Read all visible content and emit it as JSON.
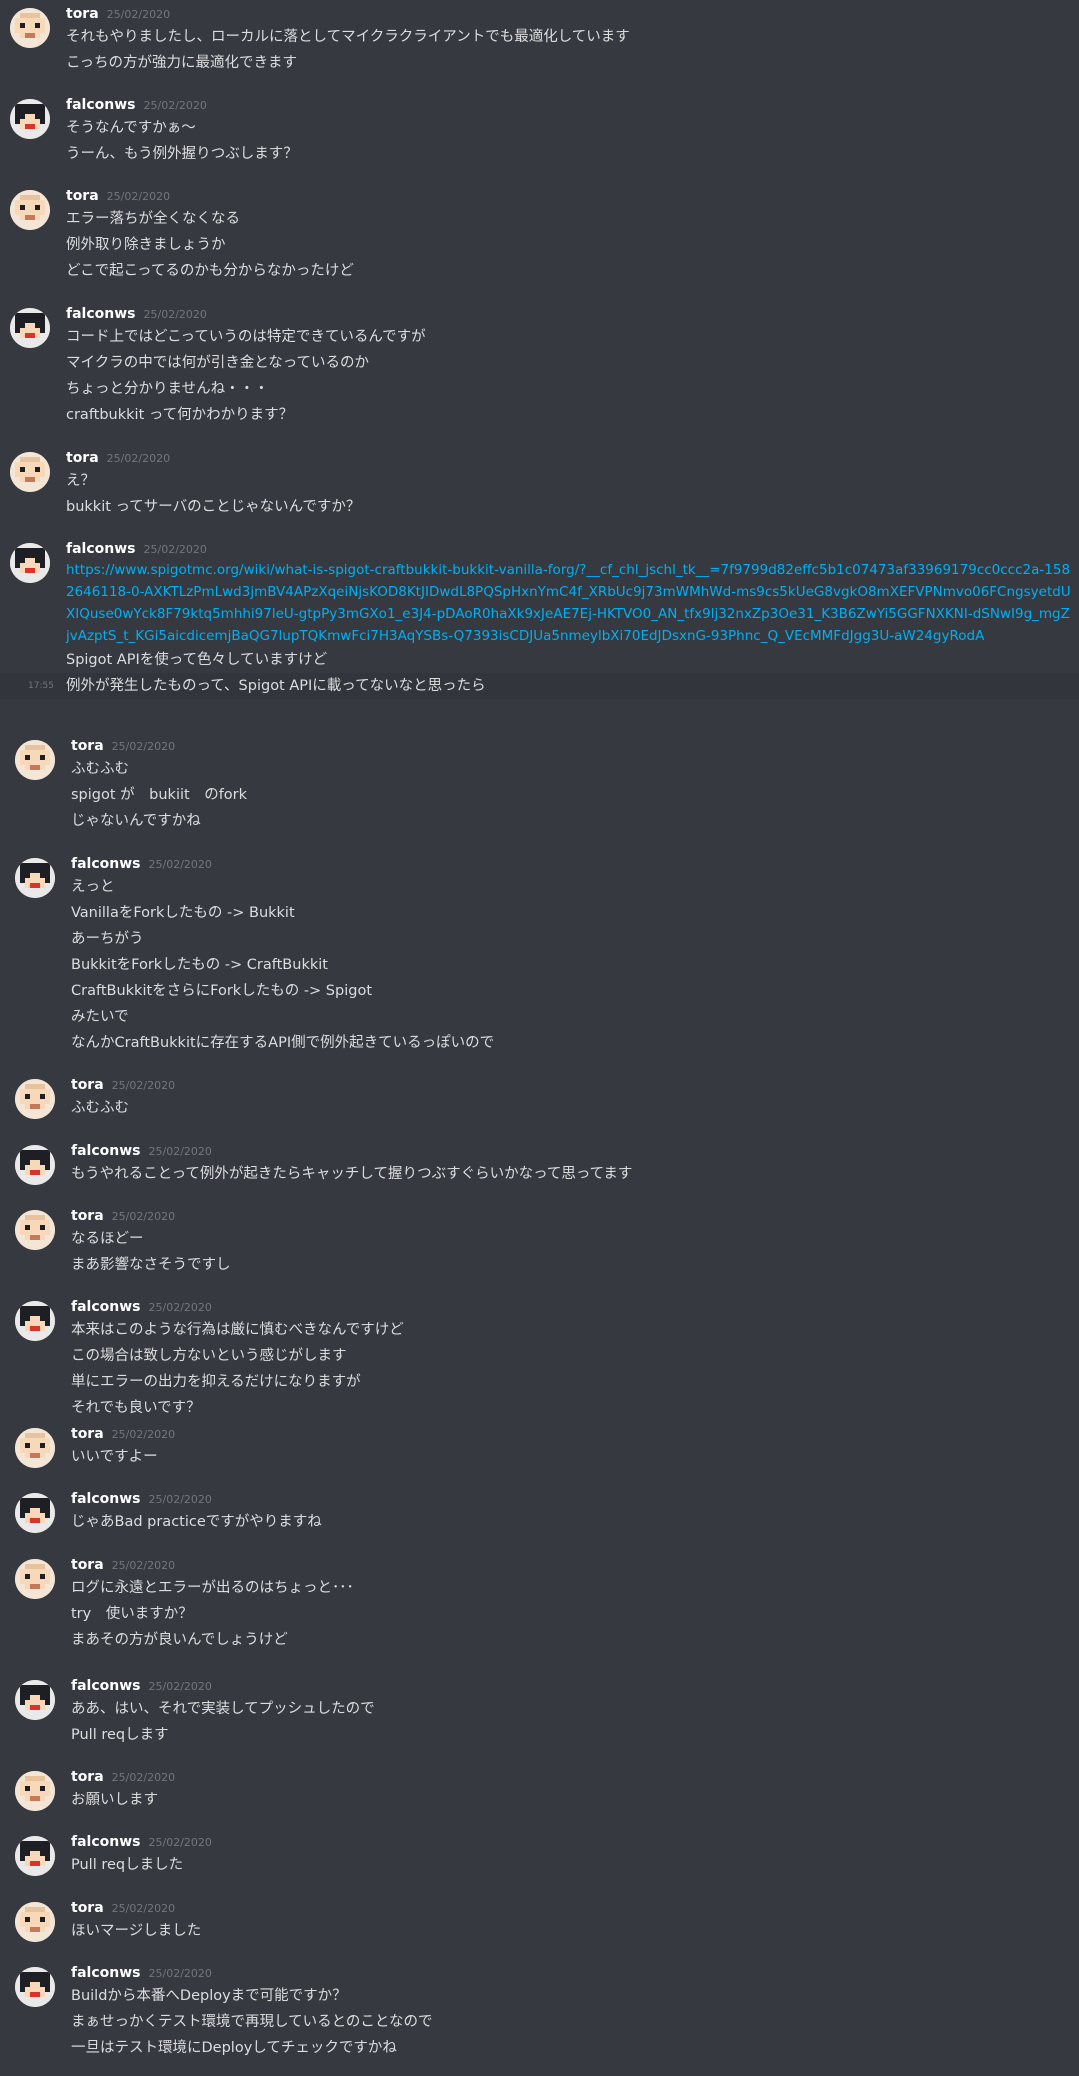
{
  "channel": {
    "messages": [
      {
        "author": "tora",
        "date": "25/02/2020",
        "lines": [
          "それもやりましたし、ローカルに落としてマイクラクライアントでも最適化しています",
          "こっちの方が強力に最適化できます"
        ]
      },
      {
        "author": "falconws",
        "date": "25/02/2020",
        "lines": [
          "そうなんですかぁ〜",
          "うーん、もう例外握りつぶします？"
        ]
      },
      {
        "author": "tora",
        "date": "25/02/2020",
        "lines": [
          "エラー落ちが全くなくなる",
          "例外取り除きましょうか",
          "どこで起こってるのかも分からなかったけど"
        ]
      },
      {
        "author": "falconws",
        "date": "25/02/2020",
        "lines": [
          "コード上ではどこっていうのは特定できているんですが",
          "マイクラの中では何が引き金となっているのか",
          "ちょっと分かりませんね・・・",
          "craftbukkit って何かわかります？"
        ]
      },
      {
        "author": "tora",
        "date": "25/02/2020",
        "lines": [
          "え？",
          "bukkit ってサーバのことじゃないんですか？"
        ]
      },
      {
        "author": "falconws",
        "date": "25/02/2020",
        "link": "https://www.spigotmc.org/wiki/what-is-spigot-craftbukkit-bukkit-vanilla-forg/?__cf_chl_jschl_tk__=7f9799d82effc5b1c07473af33969179cc0ccc2a-1582646118-0-AXKTLzPmLwd3jmBV4APzXqeiNjsKOD8KtJIDwdL8PQSpHxnYmC4f_XRbUc9j73mWMhWd-ms9cs5kUeG8vgkO8mXEFVPNmvo06FCngsyetdUXIQuse0wYck8F79ktq5mhhi97leU-gtpPy3mGXo1_e3J4-pDAoR0haXk9xJeAE7Ej-HKTVO0_AN_tfx9lj32nxZp3Oe31_K3B6ZwYi5GGFNXKNI-dSNwI9g_mgZjvAzptS_t_KGi5aicdicemjBaQG7lupTQKmwFci7H3AqYSBs-Q7393isCDJUa5nmeylbXi70EdJDsxnG-93Phnc_Q_VEcMMFdJgg3U-aW24gyRodA",
        "lines": [
          "Spigot APIを使って色々していますけど"
        ],
        "followup": {
          "time": "17:55",
          "text": "例外が発生したものって、Spigot APIに載ってないなと思ったら"
        }
      },
      {
        "author": "tora",
        "date": "25/02/2020",
        "lines": [
          "ふむふむ",
          "spigot が　bukiit　のfork",
          "じゃないんですかね"
        ]
      },
      {
        "author": "falconws",
        "date": "25/02/2020",
        "lines": [
          "えっと",
          "VanillaをForkしたもの -> Bukkit",
          "あーちがう",
          "BukkitをForkしたもの -> CraftBukkit",
          "CraftBukkitをさらにForkしたもの -> Spigot",
          "みたいで",
          "なんかCraftBukkitに存在するAPI側で例外起きているっぽいので"
        ]
      },
      {
        "author": "tora",
        "date": "25/02/2020",
        "lines": [
          "ふむふむ"
        ]
      },
      {
        "author": "falconws",
        "date": "25/02/2020",
        "lines": [
          "もうやれることって例外が起きたらキャッチして握りつぶすぐらいかなって思ってます"
        ]
      },
      {
        "author": "tora",
        "date": "25/02/2020",
        "lines": [
          "なるほどー",
          "まあ影響なさそうですし"
        ]
      },
      {
        "author": "falconws",
        "date": "25/02/2020",
        "lines": [
          "本来はこのような行為は厳に慎むべきなんですけど",
          "この場合は致し方ないという感じがします",
          "単にエラーの出力を抑えるだけになりますが",
          "それでも良いです？"
        ]
      },
      {
        "author": "tora",
        "date": "25/02/2020",
        "lines": [
          "いいですよー"
        ]
      },
      {
        "author": "falconws",
        "date": "25/02/2020",
        "lines": [
          "じゃあBad practiceですがやりますね"
        ]
      },
      {
        "author": "tora",
        "date": "25/02/2020",
        "lines": [
          "ログに永遠とエラーが出るのはちょっと･･･",
          "try　使いますか？",
          "まあその方が良いんでしょうけど"
        ]
      },
      {
        "author": "falconws",
        "date": "25/02/2020",
        "lines": [
          "ああ、はい、それで実装してプッシュしたので",
          "Pull reqします"
        ]
      },
      {
        "author": "tora",
        "date": "25/02/2020",
        "lines": [
          "お願いします"
        ]
      },
      {
        "author": "falconws",
        "date": "25/02/2020",
        "lines": [
          "Pull reqしました"
        ]
      },
      {
        "author": "tora",
        "date": "25/02/2020",
        "lines": [
          "ほいマージしました"
        ]
      },
      {
        "author": "falconws",
        "date": "25/02/2020",
        "lines": [
          "Buildから本番へDeployまで可能ですか？",
          "まぁせっかくテスト環境で再現しているとのことなので",
          "一旦はテスト環境にDeployしてチェックですかね"
        ]
      }
    ]
  }
}
